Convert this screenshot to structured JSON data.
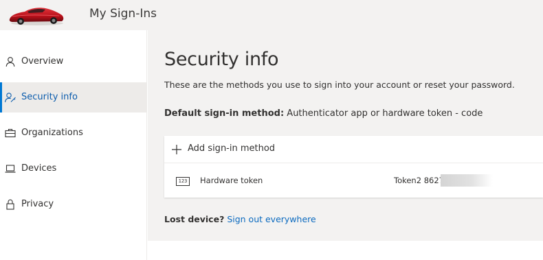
{
  "header": {
    "app_title": "My Sign-Ins",
    "logo_icon": "car-logo-icon"
  },
  "sidebar": {
    "items": [
      {
        "label": "Overview",
        "icon": "person-icon",
        "selected": false
      },
      {
        "label": "Security info",
        "icon": "person-key-icon",
        "selected": true
      },
      {
        "label": "Organizations",
        "icon": "briefcase-icon",
        "selected": false
      },
      {
        "label": "Devices",
        "icon": "laptop-icon",
        "selected": false
      },
      {
        "label": "Privacy",
        "icon": "lock-icon",
        "selected": false
      }
    ]
  },
  "main": {
    "title": "Security info",
    "subtitle": "These are the methods you use to sign into your account or reset your password.",
    "default_method_label": "Default sign-in method:",
    "default_method_value": "Authenticator app or hardware token - code",
    "add_method_label": "Add sign-in method",
    "methods": [
      {
        "icon": "hardware-token-icon",
        "icon_text": "123",
        "name": "Hardware token",
        "detail": "Token2 8627"
      }
    ],
    "lost_device_label": "Lost device?",
    "lost_device_link": "Sign out everywhere"
  },
  "colors": {
    "accent": "#0078d4",
    "link": "#0b6abf",
    "header_bg": "#f3f2f1",
    "selected_bg": "#edebe9",
    "logo_red": "#c8141e"
  }
}
